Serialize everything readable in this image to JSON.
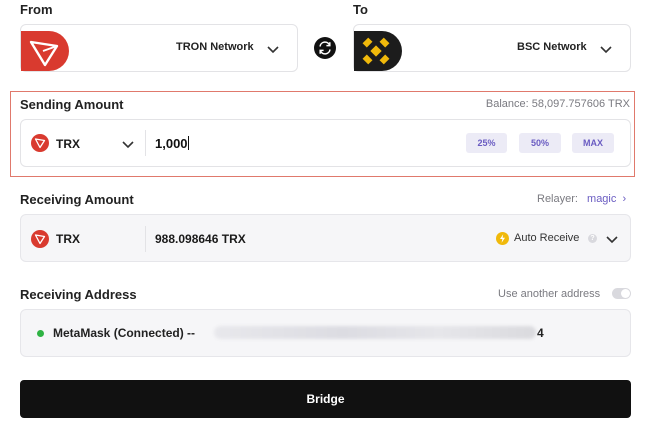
{
  "from": {
    "label": "From",
    "network": "TRON Network"
  },
  "to": {
    "label": "To",
    "network": "BSC Network"
  },
  "sending": {
    "label": "Sending Amount",
    "balance": "Balance: 58,097.757606 TRX",
    "token": "TRX",
    "amount": "1,000",
    "pct_25": "25%",
    "pct_50": "50%",
    "max": "MAX"
  },
  "receiving": {
    "label": "Receiving Amount",
    "relayer_label": "Relayer:",
    "relayer_name": "magic",
    "token": "TRX",
    "amount": "988.098646 TRX",
    "auto_receive": "Auto Receive"
  },
  "address": {
    "label": "Receiving Address",
    "use_another": "Use another address",
    "wallet": "MetaMask (Connected) --",
    "suffix": "4"
  },
  "bridge_label": "Bridge",
  "colors": {
    "tron_red": "#d93a2f",
    "bnb_yellow": "#f0b90b",
    "accent_purple": "#6a5cc2",
    "connected_green": "#2fb344"
  }
}
